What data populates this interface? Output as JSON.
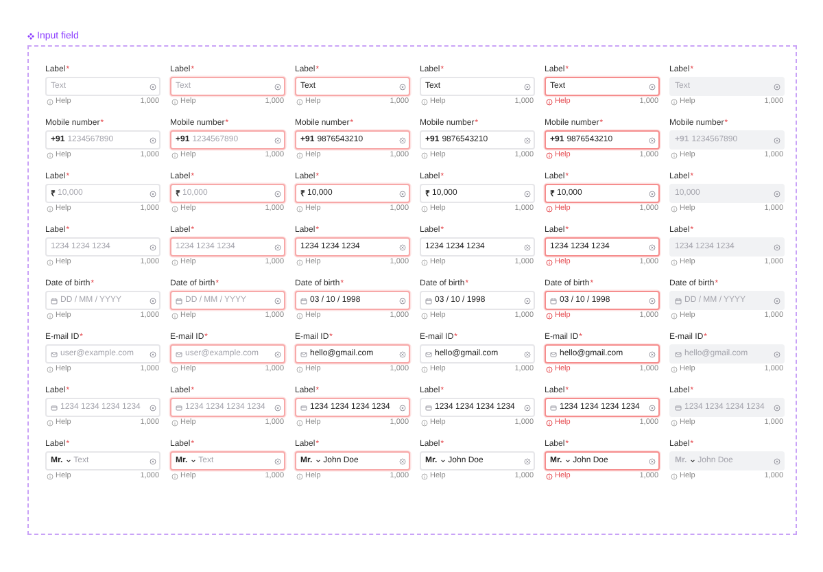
{
  "title": "Input field",
  "rows": [
    {
      "kind": "text",
      "cells": [
        {
          "kind": "default",
          "label": "Label",
          "mark": "*",
          "placeholder": "Text",
          "help": "Help",
          "count": "1,000"
        },
        {
          "kind": "focused",
          "label": "Label",
          "mark": "*",
          "placeholder": "Text",
          "help": "Help",
          "count": "1,000"
        },
        {
          "kind": "focused",
          "label": "Label",
          "mark": "*",
          "value": "Text",
          "help": "Help",
          "count": "1,000"
        },
        {
          "kind": "default",
          "label": "Label",
          "mark": "*",
          "value": "Text",
          "help": "Help",
          "count": "1,000"
        },
        {
          "kind": "error",
          "label": "Label",
          "mark": "*",
          "value": "Text",
          "help": "Help",
          "count": "1,000"
        },
        {
          "kind": "disabled",
          "label": "Label",
          "mark": "*",
          "placeholder": "Text",
          "help": "Help",
          "count": "1,000"
        }
      ]
    },
    {
      "kind": "phone",
      "cells": [
        {
          "kind": "default",
          "label": "Mobile number",
          "mark": "*",
          "prefix": "+91",
          "placeholder": "1234567890",
          "help": "Help",
          "count": "1,000"
        },
        {
          "kind": "focused",
          "label": "Mobile number",
          "mark": "*",
          "prefix": "+91",
          "placeholder": "1234567890",
          "help": "Help",
          "count": "1,000"
        },
        {
          "kind": "focused",
          "label": "Mobile number",
          "mark": "*",
          "prefix": "+91",
          "value": "9876543210",
          "help": "Help",
          "count": "1,000"
        },
        {
          "kind": "default",
          "label": "Mobile number",
          "mark": "*",
          "prefix": "+91",
          "value": "9876543210",
          "help": "Help",
          "count": "1,000"
        },
        {
          "kind": "error",
          "label": "Mobile number",
          "mark": "*",
          "prefix": "+91",
          "value": "9876543210",
          "help": "Help",
          "count": "1,000"
        },
        {
          "kind": "disabled",
          "label": "Mobile number",
          "mark": "*",
          "prefix": "+91",
          "placeholder": "1234567890",
          "help": "Help",
          "count": "1,000"
        }
      ]
    },
    {
      "kind": "amount",
      "cells": [
        {
          "kind": "default",
          "label": "Label",
          "mark": "*",
          "prefix": "₹",
          "placeholder": "10,000",
          "help": "Help",
          "count": "1,000"
        },
        {
          "kind": "focused",
          "label": "Label",
          "mark": "*",
          "prefix": "₹",
          "placeholder": "10,000",
          "help": "Help",
          "count": "1,000"
        },
        {
          "kind": "focused",
          "label": "Label",
          "mark": "*",
          "prefix": "₹",
          "value": "10,000",
          "help": "Help",
          "count": "1,000"
        },
        {
          "kind": "default",
          "label": "Label",
          "mark": "*",
          "prefix": "₹",
          "value": "10,000",
          "help": "Help",
          "count": "1,000"
        },
        {
          "kind": "error",
          "label": "Label",
          "mark": "*",
          "prefix": "₹",
          "value": "10,000",
          "help": "Help",
          "count": "1,000"
        },
        {
          "kind": "disabled",
          "label": "Label",
          "mark": "*",
          "placeholder": "10,000",
          "help": "Help",
          "count": "1,000"
        }
      ]
    },
    {
      "kind": "number",
      "cells": [
        {
          "kind": "default",
          "label": "Label",
          "mark": "*",
          "placeholder": "1234 1234 1234",
          "help": "Help",
          "count": "1,000"
        },
        {
          "kind": "focused",
          "label": "Label",
          "mark": "*",
          "placeholder": "1234 1234 1234",
          "help": "Help",
          "count": "1,000"
        },
        {
          "kind": "focused",
          "label": "Label",
          "mark": "*",
          "value": "1234 1234 1234",
          "help": "Help",
          "count": "1,000"
        },
        {
          "kind": "default",
          "label": "Label",
          "mark": "*",
          "value": "1234 1234 1234",
          "help": "Help",
          "count": "1,000"
        },
        {
          "kind": "error",
          "label": "Label",
          "mark": "*",
          "value": "1234 1234 1234",
          "help": "Help",
          "count": "1,000"
        },
        {
          "kind": "disabled",
          "label": "Label",
          "mark": "*",
          "placeholder": "1234 1234 1234",
          "help": "Help",
          "count": "1,000"
        }
      ]
    },
    {
      "kind": "date",
      "cells": [
        {
          "kind": "default",
          "label": "Date of birth",
          "mark": "*",
          "placeholder": "DD / MM / YYYY",
          "help": "Help",
          "count": "1,000"
        },
        {
          "kind": "focused",
          "label": "Date of birth",
          "mark": "*",
          "placeholder": "DD / MM / YYYY",
          "help": "Help",
          "count": "1,000"
        },
        {
          "kind": "focused",
          "label": "Date of birth",
          "mark": "*",
          "value": "03 / 10 / 1998",
          "help": "Help",
          "count": "1,000"
        },
        {
          "kind": "default",
          "label": "Date of birth",
          "mark": "*",
          "value": "03 / 10 / 1998",
          "help": "Help",
          "count": "1,000"
        },
        {
          "kind": "error",
          "label": "Date of birth",
          "mark": "*",
          "value": "03 / 10 / 1998",
          "help": "Help",
          "count": "1,000"
        },
        {
          "kind": "disabled",
          "label": "Date of birth",
          "mark": "*",
          "placeholder": "DD / MM / YYYY",
          "help": "Help",
          "count": "1,000"
        }
      ]
    },
    {
      "kind": "email",
      "cells": [
        {
          "kind": "default",
          "label": "E-mail ID",
          "mark": "*",
          "placeholder": "user@example.com",
          "help": "Help",
          "count": "1,000"
        },
        {
          "kind": "focused",
          "label": "E-mail ID",
          "mark": "*",
          "placeholder": "user@example.com",
          "help": "Help",
          "count": "1,000"
        },
        {
          "kind": "focused",
          "label": "E-mail ID",
          "mark": "*",
          "value": "hello@gmail.com",
          "help": "Help",
          "count": "1,000"
        },
        {
          "kind": "default",
          "label": "E-mail ID",
          "mark": "*",
          "value": "hello@gmail.com",
          "help": "Help",
          "count": "1,000"
        },
        {
          "kind": "error",
          "label": "E-mail ID",
          "mark": "*",
          "value": "hello@gmail.com",
          "help": "Help",
          "count": "1,000"
        },
        {
          "kind": "disabled",
          "label": "E-mail ID",
          "mark": "*",
          "placeholder": "hello@gmail.com",
          "help": "Help",
          "count": "1,000"
        }
      ]
    },
    {
      "kind": "card",
      "cells": [
        {
          "kind": "default",
          "label": "Label",
          "mark": "*",
          "placeholder": "1234 1234 1234 1234",
          "help": "Help",
          "count": "1,000"
        },
        {
          "kind": "focused",
          "label": "Label",
          "mark": "*",
          "placeholder": "1234 1234 1234 1234",
          "help": "Help",
          "count": "1,000"
        },
        {
          "kind": "focused",
          "label": "Label",
          "mark": "*",
          "value": "1234 1234 1234 1234",
          "help": "Help",
          "count": "1,000"
        },
        {
          "kind": "default",
          "label": "Label",
          "mark": "*",
          "value": "1234 1234 1234 1234",
          "help": "Help",
          "count": "1,000"
        },
        {
          "kind": "error",
          "label": "Label",
          "mark": "*",
          "value": "1234 1234 1234 1234",
          "help": "Help",
          "count": "1,000"
        },
        {
          "kind": "disabled",
          "label": "Label",
          "mark": "*",
          "placeholder": "1234 1234 1234 1234",
          "help": "Help",
          "count": "1,000"
        }
      ]
    },
    {
      "kind": "name",
      "cells": [
        {
          "kind": "default",
          "label": "Label",
          "mark": "*",
          "prefix": "Mr.",
          "placeholder": "Text",
          "help": "Help",
          "count": "1,000"
        },
        {
          "kind": "focused",
          "label": "Label",
          "mark": "*",
          "prefix": "Mr.",
          "placeholder": "Text",
          "help": "Help",
          "count": "1,000"
        },
        {
          "kind": "focused",
          "label": "Label",
          "mark": "*",
          "prefix": "Mr.",
          "value": "John Doe",
          "help": "Help",
          "count": "1,000"
        },
        {
          "kind": "default",
          "label": "Label",
          "mark": "*",
          "prefix": "Mr.",
          "value": "John Doe",
          "help": "Help",
          "count": "1,000"
        },
        {
          "kind": "error",
          "label": "Label",
          "mark": "*",
          "prefix": "Mr.",
          "value": "John Doe",
          "help": "Help",
          "count": "1,000"
        },
        {
          "kind": "disabled",
          "label": "Label",
          "mark": "*",
          "prefix": "Mr.",
          "placeholder": "John Doe",
          "help": "Help",
          "count": "1,000"
        }
      ]
    }
  ]
}
